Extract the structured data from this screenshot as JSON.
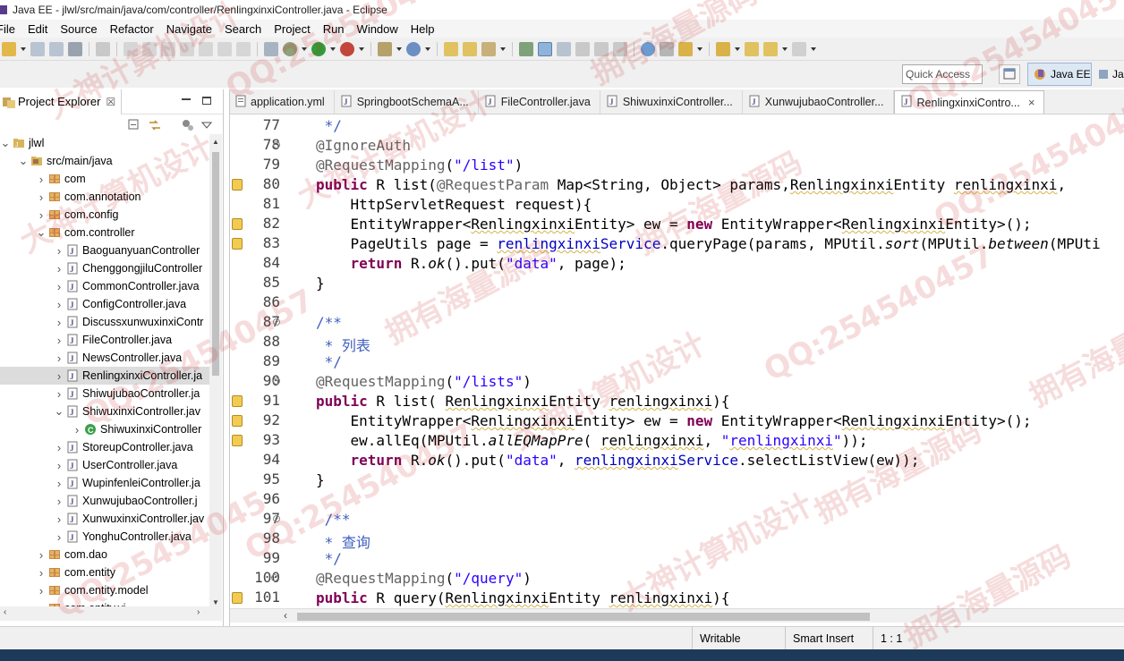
{
  "window": {
    "title": "Java EE - jlwl/src/main/java/com/controller/RenlingxinxiController.java - Eclipse"
  },
  "menu": [
    "File",
    "Edit",
    "Source",
    "Refactor",
    "Navigate",
    "Search",
    "Project",
    "Run",
    "Window",
    "Help"
  ],
  "toolbar": {
    "quick_access_placeholder": "Quick Access",
    "perspective": "Java EE",
    "perspective_clip": "Ja"
  },
  "explorer": {
    "title": "Project Explorer",
    "close": "☒",
    "tree": [
      {
        "label": "jlwl",
        "arrow": "v",
        "icon": "project-icon"
      },
      {
        "label": "src/main/java",
        "arrow": "v",
        "icon": "source-folder-icon"
      },
      {
        "label": "com",
        "arrow": ">",
        "icon": "package-icon"
      },
      {
        "label": "com.annotation",
        "arrow": ">",
        "icon": "package-icon"
      },
      {
        "label": "com.config",
        "arrow": ">",
        "icon": "package-icon"
      },
      {
        "label": "com.controller",
        "arrow": "v",
        "icon": "package-icon"
      },
      {
        "label": "BaoguanyuanController",
        "arrow": ">",
        "icon": "java-file-icon"
      },
      {
        "label": "ChenggongjiluController",
        "arrow": ">",
        "icon": "java-file-icon"
      },
      {
        "label": "CommonController.java",
        "arrow": ">",
        "icon": "java-file-icon"
      },
      {
        "label": "ConfigController.java",
        "arrow": ">",
        "icon": "java-file-icon"
      },
      {
        "label": "DiscussxunwuxinxiContr",
        "arrow": ">",
        "icon": "java-file-icon"
      },
      {
        "label": "FileController.java",
        "arrow": ">",
        "icon": "java-file-icon"
      },
      {
        "label": "NewsController.java",
        "arrow": ">",
        "icon": "java-file-icon"
      },
      {
        "label": "RenlingxinxiController.ja",
        "arrow": ">",
        "icon": "java-file-icon"
      },
      {
        "label": "ShiwujubaoController.ja",
        "arrow": ">",
        "icon": "java-file-icon"
      },
      {
        "label": "ShiwuxinxiController.jav",
        "arrow": "v",
        "icon": "java-file-icon"
      },
      {
        "label": "ShiwuxinxiController",
        "arrow": ">",
        "icon": "class-icon"
      },
      {
        "label": "StoreupController.java",
        "arrow": ">",
        "icon": "java-file-icon"
      },
      {
        "label": "UserController.java",
        "arrow": ">",
        "icon": "java-file-icon"
      },
      {
        "label": "WupinfenleiController.ja",
        "arrow": ">",
        "icon": "java-file-icon"
      },
      {
        "label": "XunwujubaoController.j",
        "arrow": ">",
        "icon": "java-file-icon"
      },
      {
        "label": "XunwuxinxiController.jav",
        "arrow": ">",
        "icon": "java-file-icon"
      },
      {
        "label": "YonghuController.java",
        "arrow": ">",
        "icon": "java-file-icon"
      },
      {
        "label": "com.dao",
        "arrow": ">",
        "icon": "package-icon"
      },
      {
        "label": "com.entity",
        "arrow": ">",
        "icon": "package-icon"
      },
      {
        "label": "com.entity.model",
        "arrow": ">",
        "icon": "package-icon"
      },
      {
        "label": "com.entity.vi...",
        "arrow": ">",
        "icon": "package-icon"
      }
    ],
    "selected_index": 13
  },
  "editor": {
    "tabs": [
      {
        "label": "application.yml",
        "active": false
      },
      {
        "label": "SpringbootSchemaA...",
        "active": false
      },
      {
        "label": "FileController.java",
        "active": false
      },
      {
        "label": "ShiwuxinxiController...",
        "active": false
      },
      {
        "label": "XunwujubaoController...",
        "active": false
      },
      {
        "label": "RenlingxinxiContro...",
        "active": true
      }
    ],
    "lines": [
      {
        "n": "77",
        "fold": "",
        "mark": false,
        "html": "<span class=\"cm\"> */</span>"
      },
      {
        "n": "78",
        "fold": "⊖",
        "mark": false,
        "html": "<span class=\"an\">@IgnoreAuth</span>"
      },
      {
        "n": "79",
        "fold": "",
        "mark": false,
        "html": "<span class=\"an\">@RequestMapping</span>(<span class=\"st\">\"/list\"</span>)"
      },
      {
        "n": "80",
        "fold": "",
        "mark": true,
        "html": "<span class=\"kw\">public</span> R list(<span class=\"an\">@RequestParam</span> Map&lt;String, Object&gt; params,<span class=\"ty\">Renlingxinxi</span>Entity <span class=\"ty\">renlingxinxi</span>,"
      },
      {
        "n": "81",
        "fold": "",
        "mark": false,
        "html": "    HttpServletRequest request){"
      },
      {
        "n": "82",
        "fold": "",
        "mark": true,
        "html": "    EntityWrapper&lt;<span class=\"ty\">Renlingxinxi</span>Entity&gt; ew = <span class=\"kw\">new</span> EntityWrapper&lt;<span class=\"ty\">Renlingxinxi</span>Entity&gt;();"
      },
      {
        "n": "83",
        "fold": "",
        "mark": true,
        "html": "    PageUtils page = <span class=\"fld\"><span class=\"ty\">renlingxinxi</span>Service</span>.queryPage(params, MPUtil.<span class=\"it\">sort</span>(MPUtil.<span class=\"it\">between</span>(MPUti"
      },
      {
        "n": "84",
        "fold": "",
        "mark": false,
        "html": "    <span class=\"kw\">return</span> R.<span class=\"it\">ok</span>().put(<span class=\"st\">\"data\"</span>, page);"
      },
      {
        "n": "85",
        "fold": "",
        "mark": false,
        "html": "}"
      },
      {
        "n": "86",
        "fold": "",
        "mark": false,
        "html": ""
      },
      {
        "n": "87",
        "fold": "⊖",
        "mark": false,
        "html": "<span class=\"cm\">/**</span>"
      },
      {
        "n": "88",
        "fold": "",
        "mark": false,
        "html": "<span class=\"cm\"> * 列表</span>"
      },
      {
        "n": "89",
        "fold": "",
        "mark": false,
        "html": "<span class=\"cm\"> */</span>"
      },
      {
        "n": "90",
        "fold": "⊖",
        "mark": false,
        "html": "<span class=\"an\">@RequestMapping</span>(<span class=\"st\">\"/lists\"</span>)"
      },
      {
        "n": "91",
        "fold": "",
        "mark": true,
        "html": "<span class=\"kw\">public</span> R list( <span class=\"ty\">Renlingxinxi</span>Entity <span class=\"ty\">renlingxinxi</span>){"
      },
      {
        "n": "92",
        "fold": "",
        "mark": true,
        "html": "    EntityWrapper&lt;<span class=\"ty\">Renlingxinxi</span>Entity&gt; ew = <span class=\"kw\">new</span> EntityWrapper&lt;<span class=\"ty\">Renlingxinxi</span>Entity&gt;();"
      },
      {
        "n": "93",
        "fold": "",
        "mark": true,
        "html": "    ew.allEq(MPUtil.<span class=\"it\">allEQMapPre</span>( <span class=\"ty\">renlingxinxi</span>, <span class=\"st\">\"<span class=\"ty\">renlingxinxi</span>\"</span>));"
      },
      {
        "n": "94",
        "fold": "",
        "mark": false,
        "html": "    <span class=\"kw\">return</span> R.<span class=\"it\">ok</span>().put(<span class=\"st\">\"data\"</span>, <span class=\"fld\"><span class=\"ty\">renlingxinxi</span>Service</span>.selectListView(ew));"
      },
      {
        "n": "95",
        "fold": "",
        "mark": false,
        "html": "}"
      },
      {
        "n": "96",
        "fold": "",
        "mark": false,
        "html": ""
      },
      {
        "n": "97",
        "fold": "⊖",
        "mark": false,
        "html": " <span class=\"cm\">/**</span>"
      },
      {
        "n": "98",
        "fold": "",
        "mark": false,
        "html": "<span class=\"cm\"> * 查询</span>"
      },
      {
        "n": "99",
        "fold": "",
        "mark": false,
        "html": "<span class=\"cm\"> */</span>"
      },
      {
        "n": "100",
        "fold": "⊖",
        "mark": false,
        "html": "<span class=\"an\">@RequestMapping</span>(<span class=\"st\">\"/query\"</span>)"
      },
      {
        "n": "101",
        "fold": "",
        "mark": true,
        "html": "<span class=\"kw\">public</span> R query(<span class=\"ty\">Renlingxinxi</span>Entity <span class=\"ty\">renlingxinxi</span>){"
      }
    ]
  },
  "status": {
    "writable": "Writable",
    "insert_mode": "Smart Insert",
    "position": "1 : 1"
  },
  "watermarks": [
    "QQ:25454045",
    "大神计算机设计",
    "拥有海量源码",
    "QQ:254540457",
    "大神计算机设计",
    "拥有海量源码",
    "QQ:254540457",
    "大神计算机设计",
    "拥有海量源码",
    "QQ:254540457",
    "拥有海量源码",
    "QQ:254540457",
    "大神计算机设计",
    "拥有海量源码",
    "QQ:254540457",
    "大神计算机设计",
    "拥有海量源码",
    "QQ:25454045"
  ],
  "colors": {
    "keyword": "#7f0055",
    "annotation": "#646464",
    "string": "#2a00ff",
    "comment": "#3f5fbf",
    "field": "#0000c0"
  }
}
